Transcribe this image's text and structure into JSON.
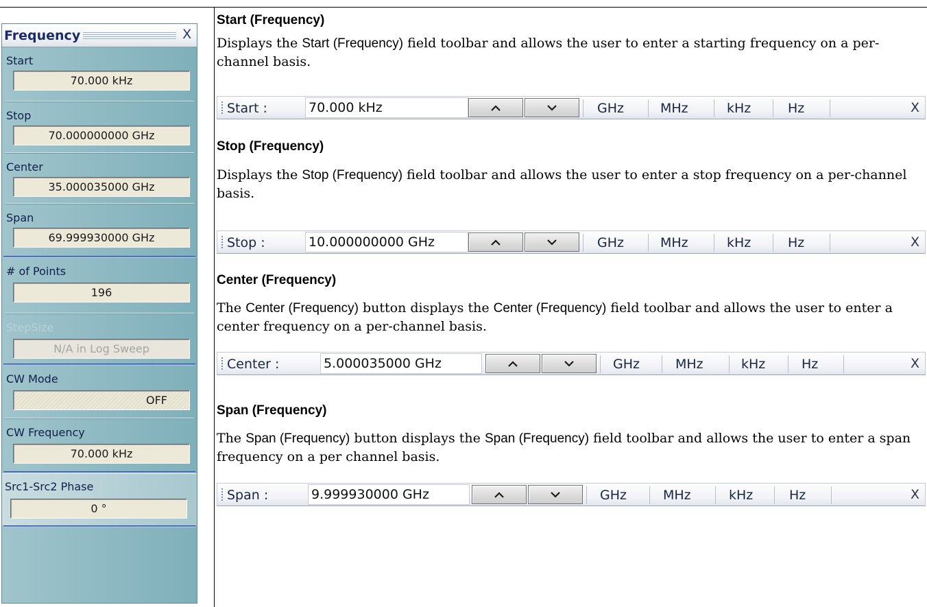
{
  "menu": {
    "title": "Frequency",
    "close": "X",
    "items": [
      {
        "label": "Start",
        "value": "70.000 kHz"
      },
      {
        "label": "Stop",
        "value": "70.000000000 GHz"
      },
      {
        "label": "Center",
        "value": "35.000035000 GHz"
      },
      {
        "label": "Span",
        "value": "69.999930000 GHz"
      },
      {
        "label": "# of Points",
        "value": "196"
      },
      {
        "label": "StepSize",
        "value": "N/A in Log Sweep"
      },
      {
        "label": "CW Mode",
        "value": "OFF"
      },
      {
        "label": "CW Frequency",
        "value": "70.000 kHz"
      },
      {
        "label": "Src1-Src2 Phase",
        "value": "0 °"
      }
    ]
  },
  "sections": [
    {
      "heading": "Start (Frequency)",
      "desc": [
        "Displays the ",
        "Start (Frequency)",
        " field toolbar and allows the user to enter a starting frequency on a per-channel basis."
      ],
      "toolbar": {
        "label": "Start  :",
        "value": "70.000 kHz"
      }
    },
    {
      "heading": "Stop (Frequency)",
      "desc": [
        "Displays the ",
        "Stop (Frequency)",
        " field toolbar and allows the user to enter a stop frequency on a per-channel basis."
      ],
      "toolbar": {
        "label": "Stop  :",
        "value": "10.000000000 GHz"
      }
    },
    {
      "heading": "Center (Frequency)",
      "desc": [
        "The ",
        "Center (Frequency)",
        " button displays the ",
        "Center (Frequency)",
        " field toolbar and allows the user to enter a center frequency on a per-channel basis."
      ],
      "toolbar": {
        "label": "Center  :",
        "value": "5.000035000 GHz"
      }
    },
    {
      "heading": "Span (Frequency)",
      "desc": [
        "The ",
        "Span (Frequency)",
        " button displays the ",
        "Span (Frequency)",
        " field toolbar and allows the user to enter a span frequency on a per channel basis."
      ],
      "toolbar": {
        "label": "Span  :",
        "value": "9.999930000 GHz"
      }
    }
  ],
  "toolbar_common": {
    "units": [
      "GHz",
      "MHz",
      "kHz",
      "Hz"
    ],
    "close": "X",
    "up_icon": "caret-up-icon",
    "down_icon": "caret-down-icon"
  },
  "colors": {
    "menu_bg": "#8fbac3",
    "menu_title": "#1c2a6a",
    "value_field_bg": "#ece9d8"
  }
}
